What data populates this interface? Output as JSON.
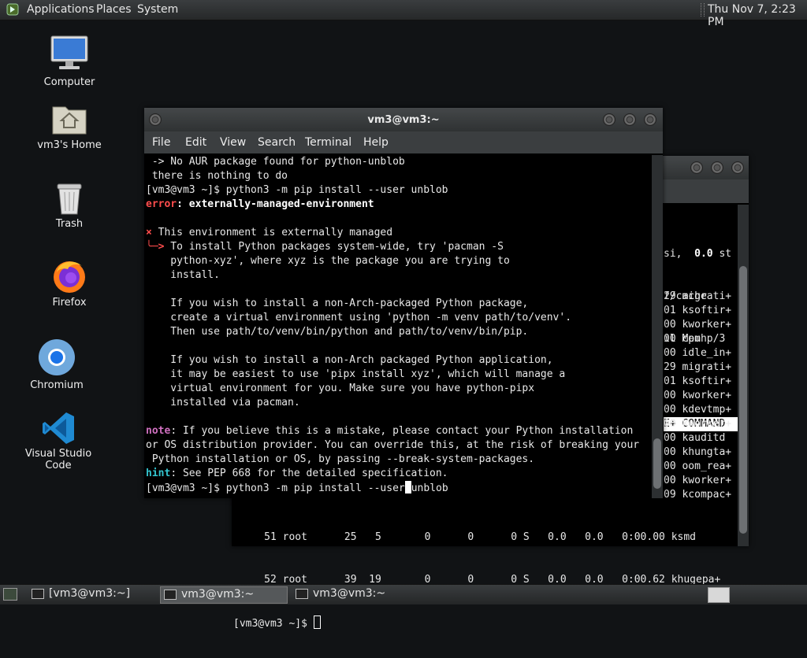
{
  "top_panel": {
    "menus": [
      "Applications",
      "Places",
      "System"
    ],
    "clock": "Thu Nov 7, 2:23 PM"
  },
  "desktop": {
    "icons": [
      {
        "label": "Computer"
      },
      {
        "label": "vm3's Home"
      },
      {
        "label": "Trash"
      },
      {
        "label": "Firefox"
      },
      {
        "label": "Chromium"
      },
      {
        "label": "Visual Studio Code"
      }
    ]
  },
  "front_window": {
    "title": "vm3@vm3:~",
    "menu": [
      "File",
      "Edit",
      "View",
      "Search",
      "Terminal",
      "Help"
    ],
    "lines": [
      " -> No AUR package found for python-unblob",
      " there is nothing to do",
      "[vm3@vm3 ~]$ python3 -m pip install --user unblob",
      {
        "prefix": "error",
        "rest": ": externally-managed-environment"
      },
      "",
      {
        "bullet": "×",
        "rest": " This environment is externally managed"
      },
      {
        "bullet": "╰─>",
        "rest": " To install Python packages system-wide, try 'pacman -S"
      },
      "    python-xyz', where xyz is the package you are trying to",
      "    install.",
      "",
      "    If you wish to install a non-Arch-packaged Python package,",
      "    create a virtual environment using 'python -m venv path/to/venv'.",
      "    Then use path/to/venv/bin/python and path/to/venv/bin/pip.",
      "",
      "    If you wish to install a non-Arch packaged Python application,",
      "    it may be easiest to use 'pipx install xyz', which will manage a",
      "    virtual environment for you. Make sure you have python-pipx",
      "    installed via pacman.",
      "",
      {
        "note": "note",
        "rest": ": If you believe this is a mistake, please contact your Python installation"
      },
      "or OS distribution provider. You can override this, at the risk of breaking your",
      " Python installation or OS, by passing --break-system-packages.",
      {
        "hint": "hint",
        "rest": ": See PEP 668 for the detailed specification."
      },
      {
        "prompt_before_cursor": "[vm3@vm3 ~]$ python3 -m pip install --user",
        "prompt_after_cursor": "unblob"
      }
    ]
  },
  "back_window": {
    "visible_top": [
      {
        "text": "si,  ",
        "bold": "0.0",
        "tail": " st"
      },
      {
        "text": "f/cache"
      },
      {
        "text": "il Mem"
      }
    ],
    "header": "E+ COMMAND",
    "rows": [
      "29 migrati+",
      "01 ksoftir+",
      "00 kworker+",
      "00 cpuhp/3",
      "00 idle_in+",
      "29 migrati+",
      "01 ksoftir+",
      "00 kworker+",
      "00 kdevtmp+",
      "00 kworker+",
      "00 kauditd",
      "00 khungta+",
      "00 oom_rea+",
      "00 kworker+",
      "09 kcompac+"
    ],
    "full_rows": [
      "     51 root      25   5       0      0      0 S   0.0   0.0   0:00.00 ksmd",
      "     52 root      39  19       0      0      0 S   0.0   0.0   0:00.62 khugepa+"
    ],
    "prompt": "[vm3@vm3 ~]$ "
  },
  "bottom_panel": {
    "tasks": [
      "[vm3@vm3:~]",
      "vm3@vm3:~",
      "vm3@vm3:~"
    ]
  }
}
